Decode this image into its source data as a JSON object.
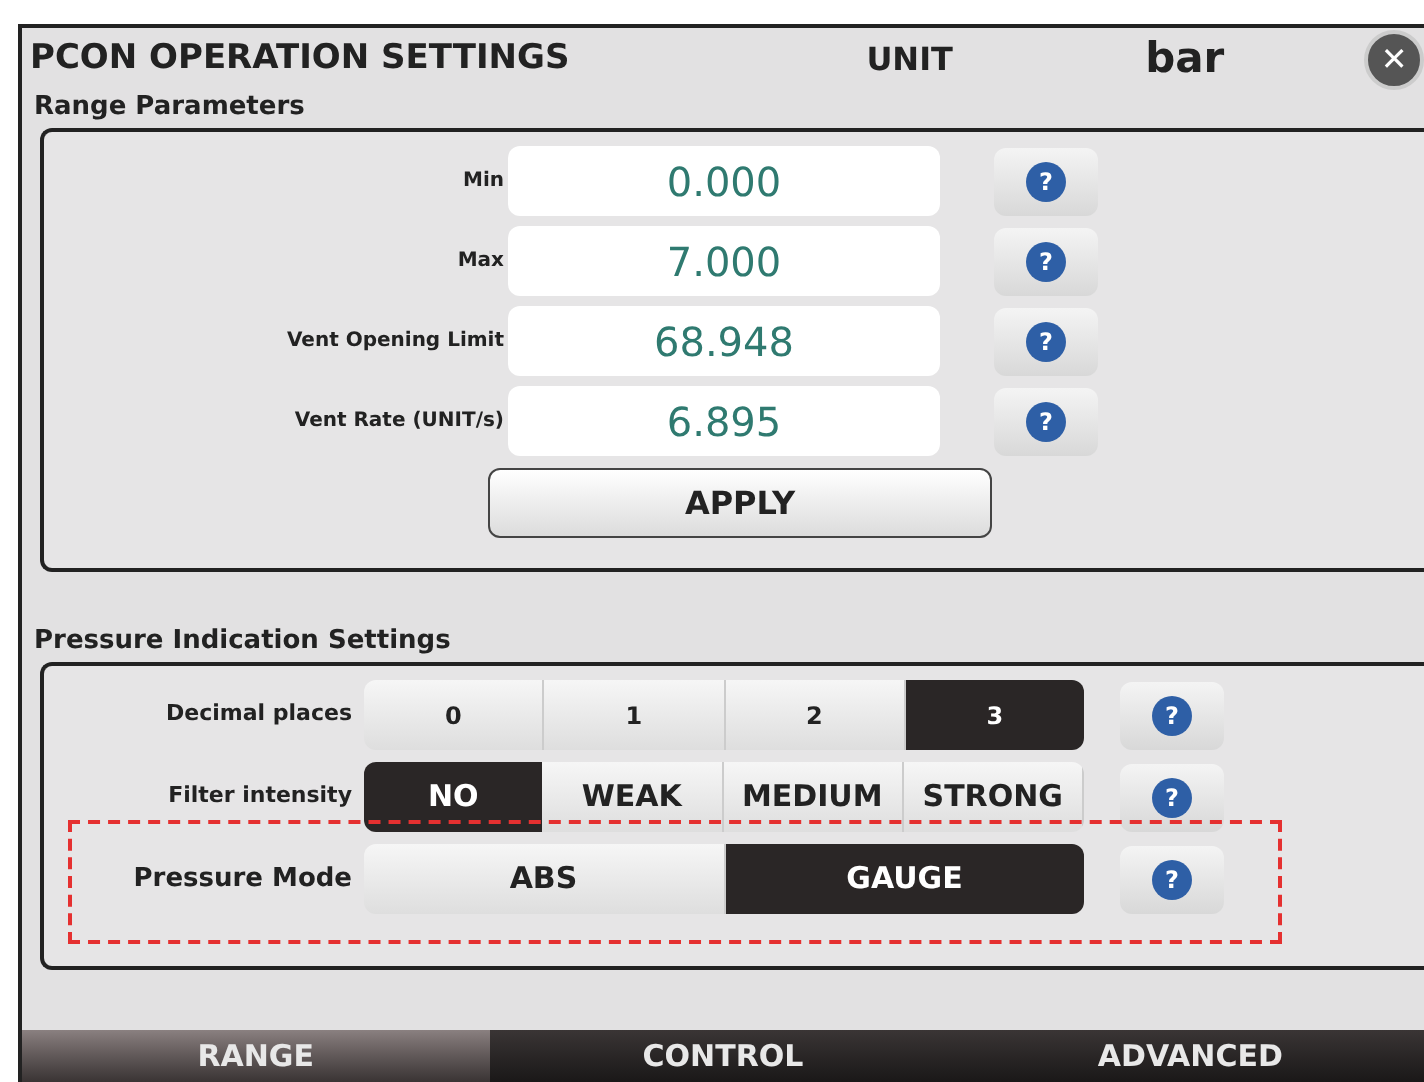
{
  "window": {
    "title": "PCON OPERATION SETTINGS",
    "unit_label": "UNIT",
    "unit_value": "bar",
    "close": "✕"
  },
  "range_parameters": {
    "title": "Range Parameters",
    "fields": [
      {
        "label": "Min",
        "value": "0.000"
      },
      {
        "label": "Max",
        "value": "7.000"
      },
      {
        "label": "Vent Opening Limit",
        "value": "68.948"
      },
      {
        "label": "Vent Rate (UNIT/s)",
        "value": "6.895"
      }
    ],
    "help": "?",
    "apply": "APPLY"
  },
  "pressure_indication": {
    "title": "Pressure Indication Settings",
    "help": "?",
    "rows": [
      {
        "label": "Decimal places",
        "highlighted": false,
        "options": [
          {
            "label": "0",
            "selected": false
          },
          {
            "label": "1",
            "selected": false
          },
          {
            "label": "2",
            "selected": false
          },
          {
            "label": "3",
            "selected": true
          }
        ]
      },
      {
        "label": "Filter intensity",
        "highlighted": false,
        "options": [
          {
            "label": "NO",
            "selected": true
          },
          {
            "label": "WEAK",
            "selected": false
          },
          {
            "label": "MEDIUM",
            "selected": false
          },
          {
            "label": "STRONG",
            "selected": false
          }
        ]
      },
      {
        "label": "Pressure Mode",
        "highlighted": true,
        "options": [
          {
            "label": "ABS",
            "selected": false
          },
          {
            "label": "GAUGE",
            "selected": true
          }
        ]
      }
    ]
  },
  "tabs": [
    {
      "label": "RANGE",
      "selected": true
    },
    {
      "label": "CONTROL",
      "selected": false
    },
    {
      "label": "ADVANCED",
      "selected": false
    }
  ]
}
